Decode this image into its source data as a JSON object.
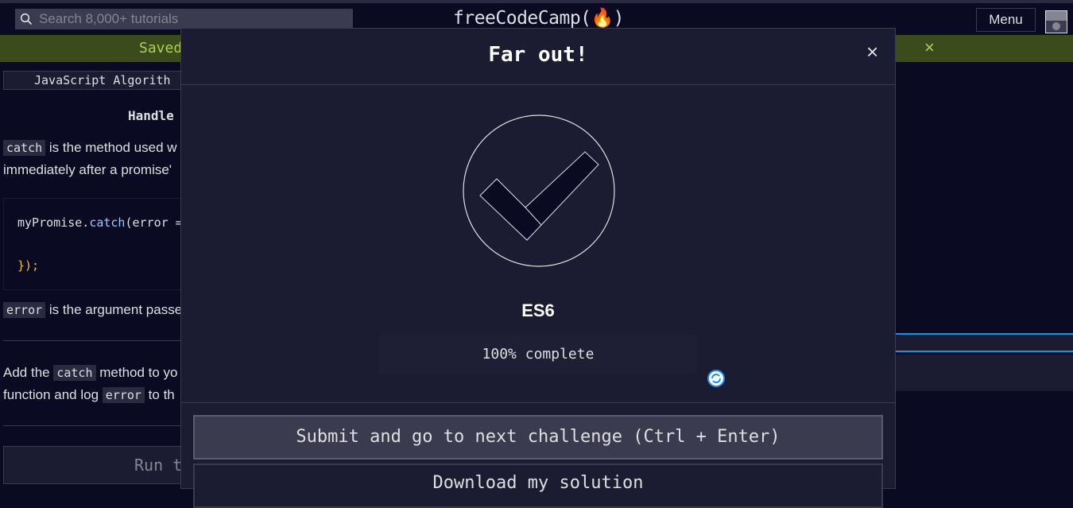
{
  "header": {
    "search_placeholder": "Search 8,000+ tutorials",
    "logo_text": "freeCodeCamp(🔥)",
    "menu_label": "Menu"
  },
  "flash": {
    "message": "Saved",
    "close_symbol": "×"
  },
  "lesson": {
    "breadcrumb": "JavaScript Algorith",
    "title": "Handle",
    "para1_code": "catch",
    "para1_text_a": "is the method used w",
    "para1_text_b": "immediately after a promise'",
    "code_line1_a": "myPromise.",
    "code_line1_b": "catch",
    "code_line1_c": "(error =",
    "code_line2": "});",
    "para2_code": "error",
    "para2_text": "is the argument passe",
    "para3_text_a": "Add the",
    "para3_code": "catch",
    "para3_text_b": "method to yo",
    "para3_text_c": "function and log",
    "para3_code2": "error",
    "para3_text_d": "to th",
    "run_label": "Run t"
  },
  "modal": {
    "title": "Far out!",
    "close_symbol": "×",
    "block_name": "ES6",
    "progress_label": "100% complete",
    "progress_value": 1.0,
    "submit_label": "Submit and go to next challenge (Ctrl + Enter)",
    "download_label": "Download my solution"
  },
  "colors": {
    "background": "#0a0a23",
    "surface": "#1b1b32",
    "flash_bg": "#3b4b1b",
    "flash_text": "#acd157",
    "accent_blue": "#198eee"
  }
}
